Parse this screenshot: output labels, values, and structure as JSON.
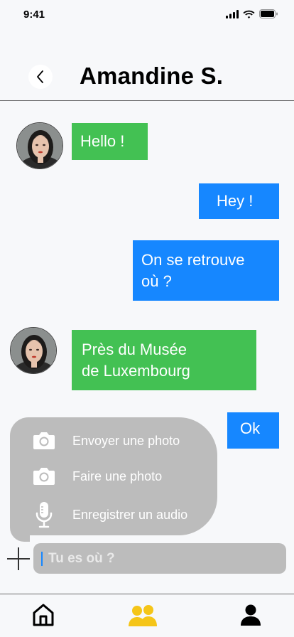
{
  "status_bar": {
    "time": "9:41",
    "icons": [
      "signal-icon",
      "wifi-icon",
      "battery-icon"
    ]
  },
  "header": {
    "back_icon": "chevron-left-icon",
    "title": "Amandine S."
  },
  "messages": [
    {
      "direction": "incoming",
      "text_lines": [
        "Hello !"
      ]
    },
    {
      "direction": "outgoing",
      "text_lines": [
        "Hey !"
      ]
    },
    {
      "direction": "outgoing",
      "text_lines": [
        "On se retrouve",
        "où ?"
      ]
    },
    {
      "direction": "incoming",
      "text_lines": [
        "Près du Musée",
        "de Luxembourg"
      ]
    },
    {
      "direction": "outgoing",
      "text_lines": [
        "Ok"
      ]
    }
  ],
  "attach_menu": {
    "items": [
      {
        "icon": "camera-icon",
        "label": "Envoyer une photo"
      },
      {
        "icon": "camera-icon",
        "label": "Faire une photo"
      },
      {
        "icon": "microphone-icon",
        "label": "Enregistrer un audio"
      }
    ]
  },
  "composer": {
    "plus_icon": "plus-icon",
    "placeholder": "Tu es où ?"
  },
  "tabbar": {
    "items": [
      {
        "icon": "home-icon",
        "active": false
      },
      {
        "icon": "users-icon",
        "active": true
      },
      {
        "icon": "user-icon",
        "active": false
      }
    ]
  },
  "colors": {
    "incoming_bubble": "#43c153",
    "outgoing_bubble": "#1687ff",
    "menu_background": "#bcbcbc",
    "active_tab": "#f5c518",
    "background": "#f7f8fa"
  }
}
